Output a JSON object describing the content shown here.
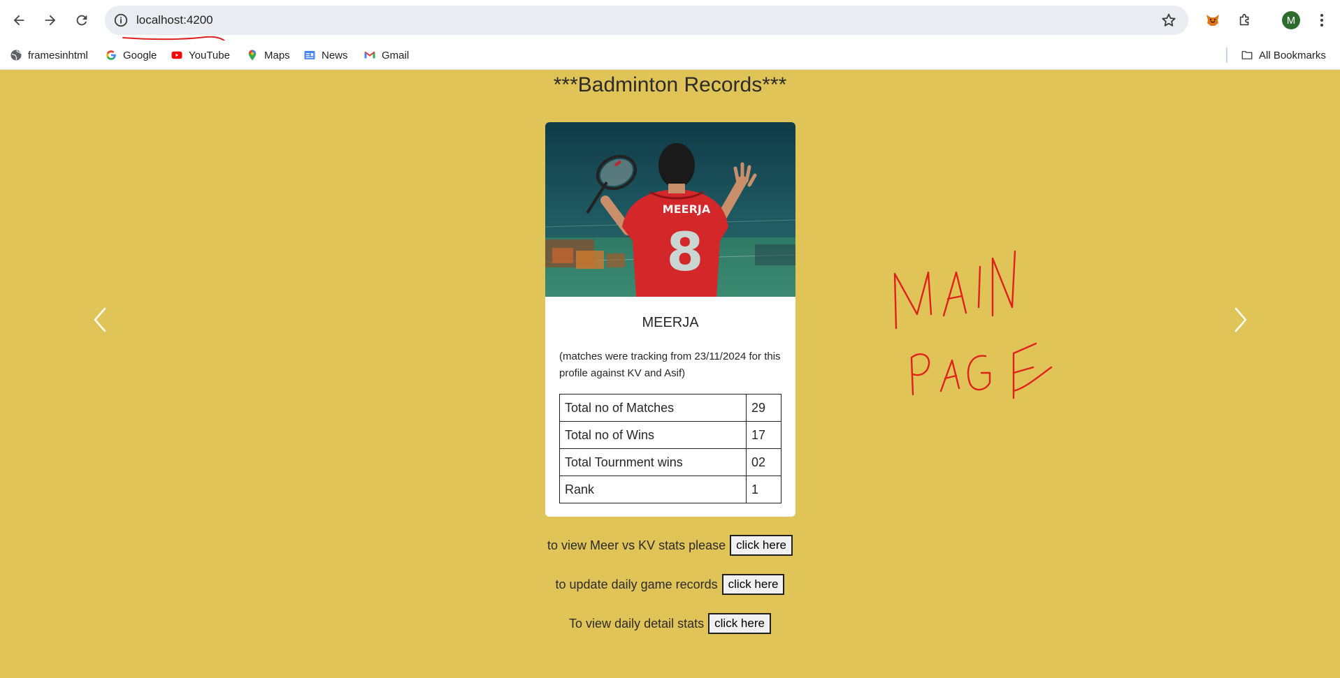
{
  "browser": {
    "url": "localhost:4200",
    "profile_initial": "M",
    "bookmarks": [
      {
        "label": "framesinhtml",
        "icon": "globe-icon"
      },
      {
        "label": "Google",
        "icon": "google-icon"
      },
      {
        "label": "YouTube",
        "icon": "youtube-icon"
      },
      {
        "label": "Maps",
        "icon": "maps-icon"
      },
      {
        "label": "News",
        "icon": "news-icon"
      },
      {
        "label": "Gmail",
        "icon": "gmail-icon"
      }
    ],
    "all_bookmarks": "All Bookmarks"
  },
  "page": {
    "title": "***Badminton Records***",
    "background": "#e0c457",
    "card": {
      "jersey_name": "MEERJA",
      "jersey_number": "8",
      "name": "MEERJA",
      "note": "(matches were tracking from 23/11/2024 for this profile against KV and Asif)",
      "stats": [
        {
          "label": "Total no of Matches",
          "value": "29"
        },
        {
          "label": "Total no of Wins",
          "value": "17"
        },
        {
          "label": "Total Tournment wins",
          "value": "02"
        },
        {
          "label": "Rank",
          "value": "1"
        }
      ]
    },
    "actions": [
      {
        "text": "to view Meer vs KV stats please",
        "button": "click here"
      },
      {
        "text": "to update daily game records",
        "button": "click here"
      },
      {
        "text": "To view daily detail stats",
        "button": "click here"
      }
    ]
  }
}
